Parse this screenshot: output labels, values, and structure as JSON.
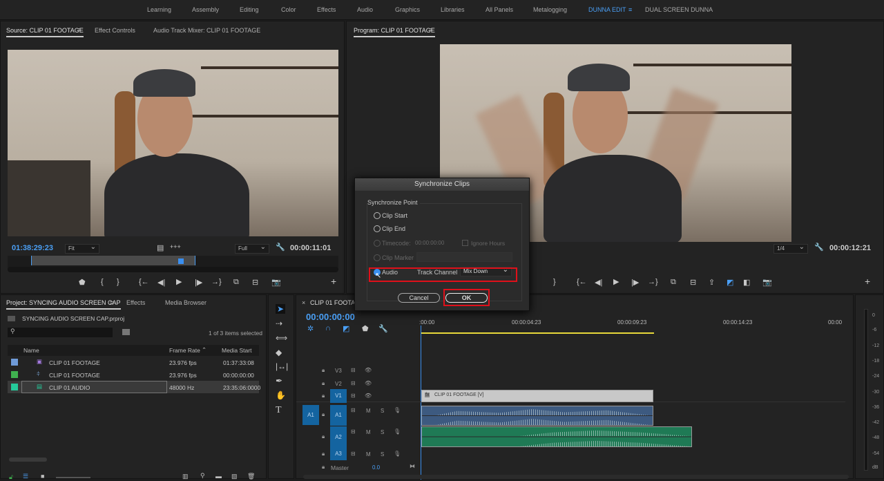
{
  "workspaces": [
    "Learning",
    "Assembly",
    "Editing",
    "Color",
    "Effects",
    "Audio",
    "Graphics",
    "Libraries",
    "All Panels",
    "Metalogging",
    "DUNNA EDIT",
    "DUAL SCREEN DUNNA"
  ],
  "active_workspace": "DUNNA EDIT",
  "source": {
    "tabs": [
      "Source: CLIP 01 FOOTAGE",
      "Effect Controls",
      "Audio Track Mixer: CLIP 01 FOOTAGE"
    ],
    "timecode": "01:38:29:23",
    "fit": "Fit",
    "quality": "Full",
    "duration": "00:00:11:01"
  },
  "program": {
    "tab": "Program: CLIP 01 FOOTAGE",
    "zoom": "1/4",
    "duration": "00:00:12:21"
  },
  "dialog": {
    "title": "Synchronize Clips",
    "group": "Synchronize Point",
    "clip_start": "Clip Start",
    "clip_end": "Clip End",
    "timecode_label": "Timecode:",
    "timecode_value": "00:00:00:00",
    "ignore_hours": "Ignore Hours",
    "clip_marker": "Clip Marker",
    "audio": "Audio",
    "track_channel": "Track Channel",
    "track_channel_value": "Mix Down",
    "cancel": "Cancel",
    "ok": "OK"
  },
  "project": {
    "tabs": [
      "Project: SYNCING AUDIO SCREEN CAP",
      "Effects",
      "Media Browser"
    ],
    "file": "SYNCING AUDIO SCREEN CAP.prproj",
    "selection": "1 of 3 items selected",
    "columns": [
      "Name",
      "Frame Rate",
      "Media Start"
    ],
    "rows": [
      {
        "name": "CLIP 01 FOOTAGE",
        "rate": "23.976 fps",
        "start": "01:37:33:08",
        "color": "#6f9bd8"
      },
      {
        "name": "CLIP 01 FOOTAGE",
        "rate": "23.976 fps",
        "start": "00:00:00:00",
        "color": "#3fb04f"
      },
      {
        "name": "CLIP 01 AUDIO",
        "rate": "48000 Hz",
        "start": "23:35:06:0000",
        "color": "#25c99a"
      }
    ]
  },
  "timeline": {
    "tab": "CLIP 01 FOOTAGE",
    "timecode": "00:00:00:00",
    "ruler": [
      ":00:00",
      "00:00:04:23",
      "00:00:09:23",
      "00:00:14:23",
      "00:00"
    ],
    "tracks": {
      "v3": "V3",
      "v2": "V2",
      "v1": "V1",
      "a1src": "A1",
      "a1": "A1",
      "a2": "A2",
      "a3": "A3",
      "master": "Master",
      "master_val": "0.0",
      "m": "M",
      "s": "S"
    },
    "video_clip": "CLIP 01 FOOTAGE [V]",
    "fx": "fx"
  },
  "meter": {
    "ticks": [
      "0",
      "-6",
      "-12",
      "-18",
      "-24",
      "-30",
      "-36",
      "-42",
      "-48",
      "-54",
      "dB"
    ]
  }
}
